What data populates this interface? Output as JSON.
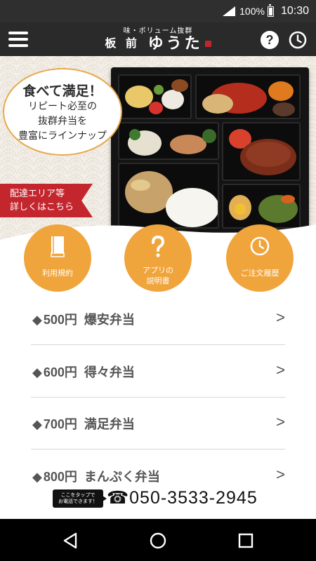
{
  "status_bar": {
    "battery_percent": "100%",
    "time": "10:30"
  },
  "header": {
    "tagline": "味・ボリューム抜群",
    "brand_name_1": "板 前",
    "brand_name_2": "ゆうた",
    "help_label": "?"
  },
  "hero": {
    "headline": "食べて満足！",
    "copy_line_1": "リピート必至の",
    "copy_line_2": "抜群弁当を",
    "copy_line_3": "豊富にラインナップ",
    "delivery_line_1": "配達エリア等",
    "delivery_line_2": "詳しくはこちら"
  },
  "circle_buttons": [
    {
      "label": "利用規約",
      "icon": "book-icon"
    },
    {
      "label": "アプリの\n説明書",
      "icon": "question-icon"
    },
    {
      "label": "ご注文履歴",
      "icon": "clock-icon"
    }
  ],
  "menu": {
    "items": [
      {
        "price": "500円",
        "name": "爆安弁当"
      },
      {
        "price": "600円",
        "name": "得々弁当"
      },
      {
        "price": "700円",
        "name": "満足弁当"
      },
      {
        "price": "800円",
        "name": "まんぷく弁当"
      }
    ],
    "chevron": ">",
    "bullet": "◆"
  },
  "phone": {
    "hint_line_1": "ここをタップで",
    "hint_line_2": "お電話できます！",
    "phone_icon": "☎",
    "number": "050-3533-2945"
  },
  "colors": {
    "accent_orange": "#f0a43c",
    "banner_red": "#c4262e",
    "header_dark": "#2a2a2a"
  }
}
